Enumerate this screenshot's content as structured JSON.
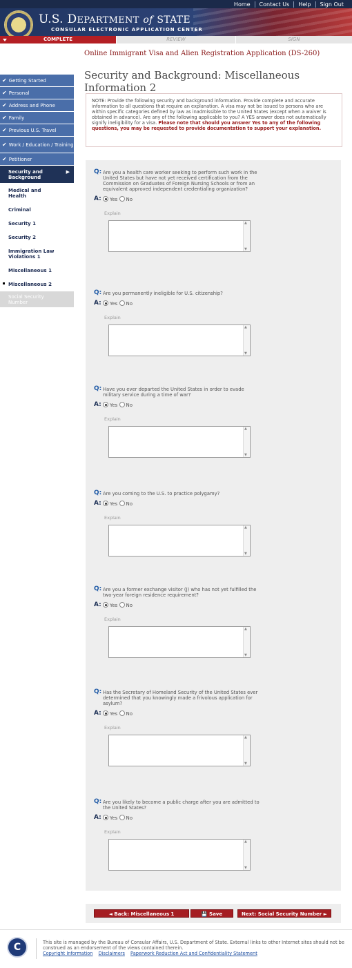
{
  "header": {
    "top_links": [
      "Home",
      "Contact Us",
      "Help",
      "Sign Out"
    ],
    "dept_us": "U.S. D",
    "dept_epartment": "EPARTMENT",
    "dept_of": "of",
    "dept_state": "STATE",
    "ceac": "CONSULAR ELECTRONIC APPLICATION CENTER"
  },
  "progress": {
    "complete": "COMPLETE",
    "review": "REVIEW",
    "sign": "SIGN"
  },
  "app_title": "Online Immigrant Visa and Alien Registration Application (DS-260)",
  "page_title": "Security and Background: Miscellaneous Information 2",
  "note": {
    "text": "NOTE: Provide the following security and background information. Provide complete and accurate information to all questions that require an explanation. A visa may not be issued to persons who are within specific categories defined by law as inadmissible to the United States (except when a waiver is obtained in advance). Are any of the following applicable to you? A YES answer does not automatically signify ineligibility for a visa.",
    "bold": "Please note that should you answer Yes to any of the following questions, you may be requested to provide documentation to support your explanation."
  },
  "sidebar": {
    "done_items": [
      "Getting Started",
      "Personal",
      "Address and Phone",
      "Family",
      "Previous U.S. Travel",
      "Work / Education / Training",
      "Petitioner"
    ],
    "current": "Security and Background",
    "sub_items": [
      "Medical and Health",
      "Criminal",
      "Security 1",
      "Security 2",
      "Immigration Law Violations 1",
      "Miscellaneous 1",
      "Miscellaneous 2"
    ],
    "disabled": "Social Security Number"
  },
  "form": {
    "q_label": "Q:",
    "a_label": "A:",
    "yes": "Yes",
    "no": "No",
    "explain": "Explain",
    "questions": [
      "Are you a health care worker seeking to perform such work in the United States but have not yet received certification from the Commission on Graduates of Foreign Nursing Schools or from an equivalent approved independent credentialing organization?",
      "Are you permanently ineligible for U.S. citizenship?",
      "Have you ever departed the United States in order to evade military service during a time of war?",
      "Are you coming to the U.S. to practice polygamy?",
      "Are you a former exchange visitor (J) who has not yet fulfilled the two-year foreign residence requirement?",
      "Has the Secretary of Homeland Security of the United States ever determined that you knowingly made a frivolous application for asylum?",
      "Are you likely to become a public charge after you are admitted to the United States?"
    ],
    "selected": "Yes"
  },
  "buttons": {
    "back": "◄ Back: Miscellaneous 1",
    "save": "💾 Save",
    "next": "Next: Social Security Number ►"
  },
  "footer": {
    "text": "This site is managed by the Bureau of Consular Affairs, U.S. Department of State. External links to other Internet sites should not be construed as an endorsement of the views contained therein.",
    "links": [
      "Copyright Information",
      "Disclaimers",
      "Paperwork Reduction Act and Confidentiality Statement"
    ],
    "seal_letter": "C"
  }
}
